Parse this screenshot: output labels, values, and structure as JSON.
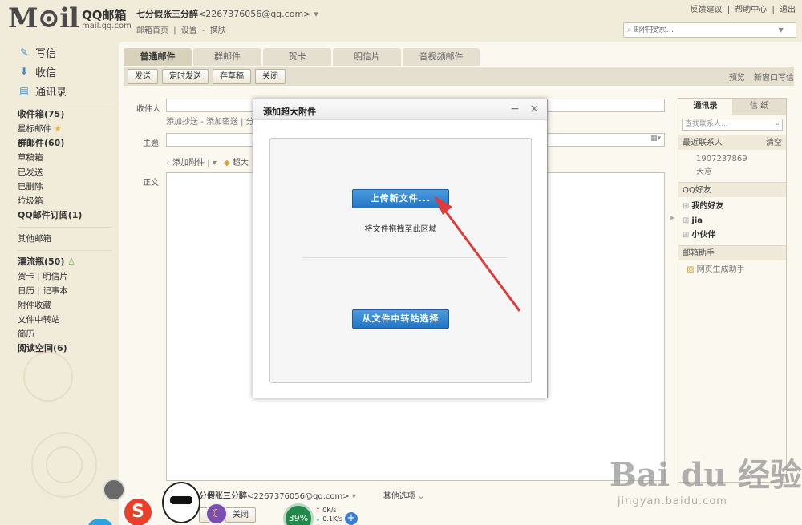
{
  "header": {
    "logo_text": "M⊙il",
    "brand_cn": "QQ邮箱",
    "brand_url": "mail.qq.com",
    "user_name": "七分假张三分醉",
    "user_email": "<2267376056@qq.com>",
    "links": [
      "邮箱首页",
      "|",
      "设置",
      "-",
      "换肤"
    ],
    "toplinks": [
      "反馈建议",
      "|",
      "帮助中心",
      "|",
      "退出"
    ],
    "search_placeholder": "邮件搜索..."
  },
  "sidebar": {
    "big": [
      {
        "label": "写信",
        "icon": "compose-icon"
      },
      {
        "label": "收信",
        "icon": "inbox-icon"
      },
      {
        "label": "通讯录",
        "icon": "contacts-icon"
      }
    ],
    "folders": [
      "收件箱(75)",
      "星标邮件",
      "群邮件(60)",
      "草稿箱",
      "已发送",
      "已删除",
      "垃圾箱",
      "QQ邮件订阅(1)"
    ],
    "other": "其他邮箱",
    "drift": "漂流瓶(50)",
    "extras": [
      "贺卡",
      "明信片",
      "日历",
      "记事本",
      "附件收藏",
      "文件中转站",
      "简历",
      "阅读空间(6)"
    ]
  },
  "tabs": [
    "普通邮件",
    "群邮件",
    "贺卡",
    "明信片",
    "音视频邮件"
  ],
  "toolbar": {
    "buttons": [
      "发送",
      "定时发送",
      "存草稿",
      "关闭"
    ],
    "right": [
      "预览",
      "新窗口写信"
    ]
  },
  "compose": {
    "to_label": "收件人",
    "to_sublinks": "添加抄送 - 添加密送 | 分",
    "subject_label": "主题",
    "attach_label": "添加附件",
    "super_label": "超大",
    "body_label": "正文"
  },
  "contacts": {
    "tabs": [
      "通讯录",
      "信 纸"
    ],
    "search_placeholder": "查找联系人...",
    "recent_label": "最近联系人",
    "clear_label": "清空",
    "recent_items": [
      "1907237869",
      "天意"
    ],
    "friends_label": "QQ好友",
    "groups": [
      "我的好友",
      "jia",
      "小伙伴"
    ],
    "assistant_label": "邮箱助手",
    "assistant_item": "网页生成助手"
  },
  "bottom": {
    "from_name": "七分假张三分醉",
    "from_email": "<2267376056@qq.com>",
    "other_options": "其他选项",
    "buttons": [
      "稿",
      "关闭"
    ],
    "gauge": "39%",
    "up_speed": "0K/s",
    "down_speed": "0.1K/s"
  },
  "dialog": {
    "title": "添加超大附件",
    "upload_btn": "上传新文件...",
    "drop_hint": "将文件拖拽至此区域",
    "transfer_btn": "从文件中转站选择"
  },
  "watermark": {
    "big": "Bai du 经验",
    "small": "jingyan.baidu.com"
  }
}
